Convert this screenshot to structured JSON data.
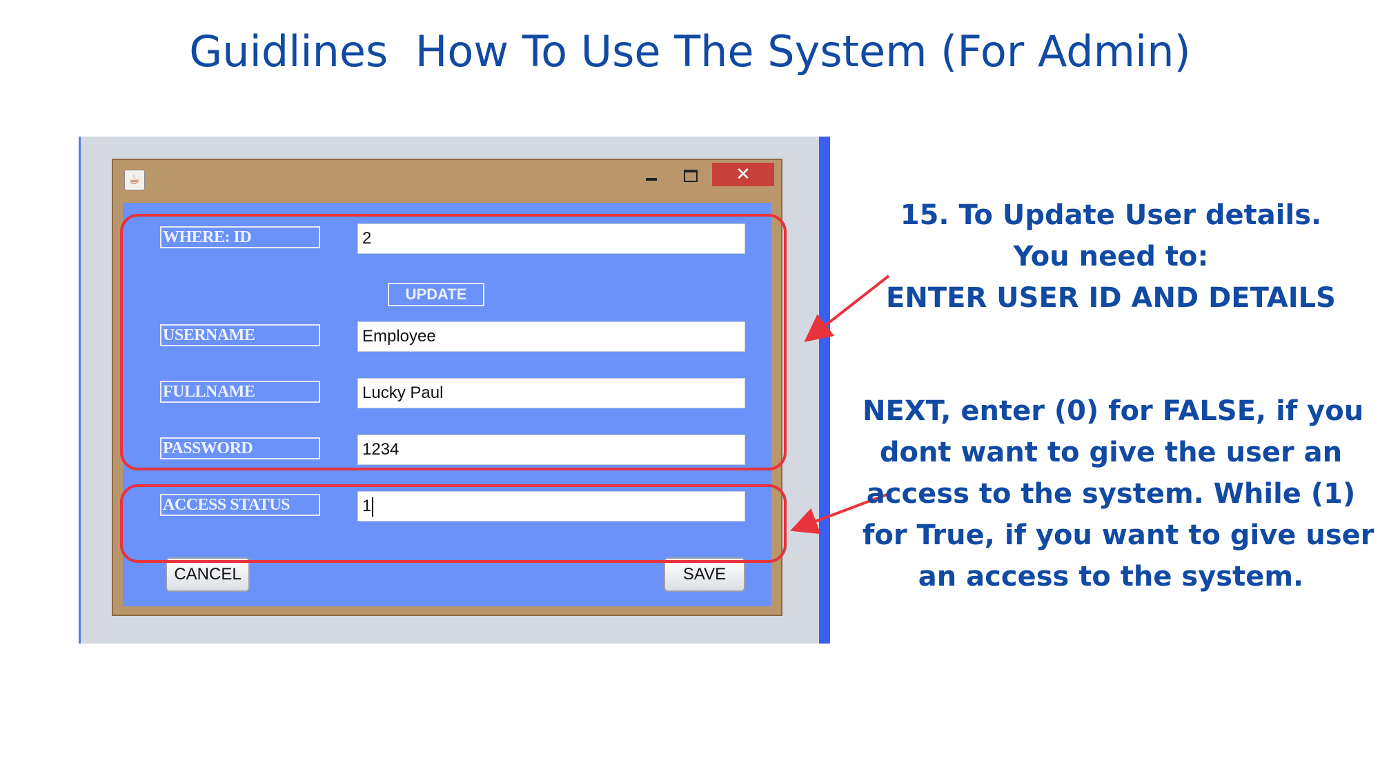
{
  "title": "Guidlines  How To Use The System (For Admin)",
  "window": {
    "icon": "java-cup-icon",
    "controls": {
      "close": "✕"
    }
  },
  "form": {
    "where_id_label": "WHERE: ID",
    "where_id_value": "2",
    "update_label": "UPDATE",
    "username_label": "USERNAME",
    "username_value": "Employee",
    "fullname_label": "FULLNAME",
    "fullname_value": "Lucky Paul",
    "password_label": "PASSWORD",
    "password_value": "1234",
    "access_status_label": "ACCESS STATUS",
    "access_status_value": "1",
    "cancel_label": "CANCEL",
    "save_label": "SAVE"
  },
  "notes": {
    "step": {
      "line1": "15. To Update User details.",
      "line2": "You need to:",
      "line3": "ENTER USER ID AND DETAILS"
    },
    "access": {
      "line1": "NEXT, enter (0) for FALSE, if you",
      "line2": "dont want to give the user an",
      "line3": "access to the system. While (1)",
      "line4": "for True, if you want to give user",
      "line5": "an access to the system."
    }
  },
  "colors": {
    "title": "#114aa3",
    "highlight": "#e8333d",
    "window_frame": "#b9976b",
    "client_bg": "#6a92f8",
    "close_button": "#c9403a"
  }
}
